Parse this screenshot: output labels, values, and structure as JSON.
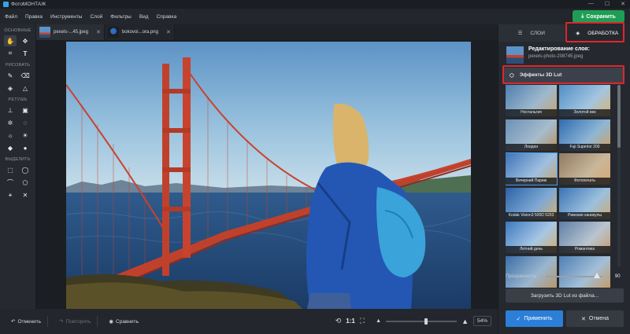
{
  "window": {
    "title": "ФотоМОНТАЖ",
    "controls": [
      "—",
      "☐",
      "✕"
    ]
  },
  "menu": [
    "Файл",
    "Правка",
    "Инструменты",
    "Слой",
    "Фильтры",
    "Вид",
    "Справка"
  ],
  "save_button": "Сохранить",
  "toolbar": {
    "sections": [
      "ОСНОВНЫЕ",
      "РИСОВАТЬ",
      "РЕТУШЬ",
      "ВЫДЕЛИТЬ"
    ]
  },
  "tabs": [
    {
      "label": "pexels-...45.jpeg",
      "close": "✕"
    },
    {
      "label": "bokovoi...ora.png",
      "close": "✕"
    }
  ],
  "bottom": {
    "undo": "Отменить",
    "redo": "Повторить",
    "compare": "Сравнить",
    "one_to_one": "1:1",
    "zoom": "54%",
    "zoom_fraction": 0.54
  },
  "panel": {
    "tab_layers": "СЛОИ",
    "tab_processing": "ОБРАБОТКА",
    "edit_title": "Редактирование слоя:",
    "edit_file": "pexels-photo-208745.jpeg",
    "effect_header": "Эффекты 3D Lut",
    "luts": [
      "Ностальгия",
      "Золотой век",
      "Лондон",
      "Fuji Superior 200",
      "Вечерний Париж",
      "Фотопечать",
      "Kodak Vision3 500D 5203",
      "Римские каникулы",
      "Летний день",
      "Романтика",
      "",
      ""
    ],
    "selected_lut": "Вечерний Париж",
    "opacity_label": "Прозрачность",
    "opacity_value": "90",
    "opacity_fraction": 0.9,
    "load_lut": "Загрузить 3D Lut из файла...",
    "apply": "Применить",
    "cancel": "Отмена"
  },
  "colors": {
    "accent_blue": "#2b7fd8",
    "save_green": "#1f9d55",
    "highlight_red": "#e0262b"
  }
}
